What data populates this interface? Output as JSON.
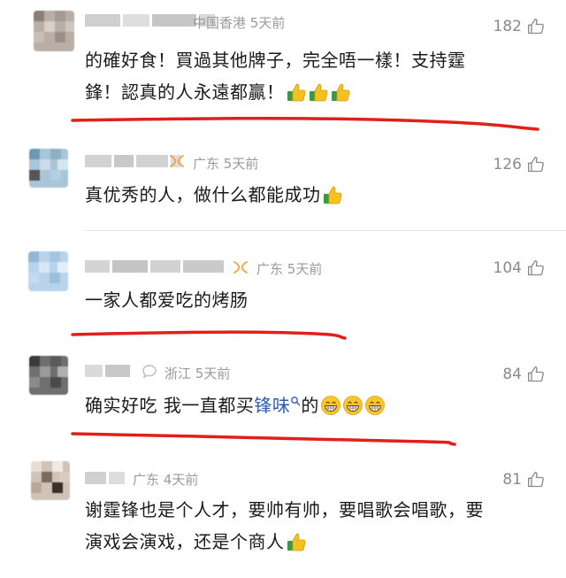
{
  "comments": [
    {
      "location": "中国香港",
      "time": "5天前",
      "likes": "182",
      "text_line1": "的確好食！買過其他牌子，完全唔一樣！支持霆",
      "text_line2": "鋒！認真的人永遠都贏！",
      "emojis": [
        "thumbs-up",
        "thumbs-up",
        "thumbs-up"
      ]
    },
    {
      "location": "广东",
      "time": "5天前",
      "likes": "126",
      "text_line1": "真优秀的人，做什么都能成功",
      "emojis": [
        "thumbs-up"
      ]
    },
    {
      "location": "广东",
      "time": "5天前",
      "likes": "104",
      "text_line1": "一家人都爱吃的烤肠"
    },
    {
      "location": "浙江",
      "time": "5天前",
      "likes": "84",
      "text_prefix": "确实好吃 我一直都买",
      "keyword": "锋味",
      "text_suffix": "的",
      "emojis": [
        "grin",
        "grin",
        "grin"
      ]
    },
    {
      "location": "广东",
      "time": "4天前",
      "likes": "81",
      "text_line1": "谢霆锋也是个人才，要帅有帅，要唱歌会唱歌，要",
      "text_line2": "演戏会演戏，还是个商人",
      "emojis": [
        "thumbs-up"
      ]
    }
  ],
  "colors": {
    "annotation_red": "#e0201c",
    "keyword_blue": "#2a5db0",
    "meta_gray": "#9a9a9a"
  }
}
